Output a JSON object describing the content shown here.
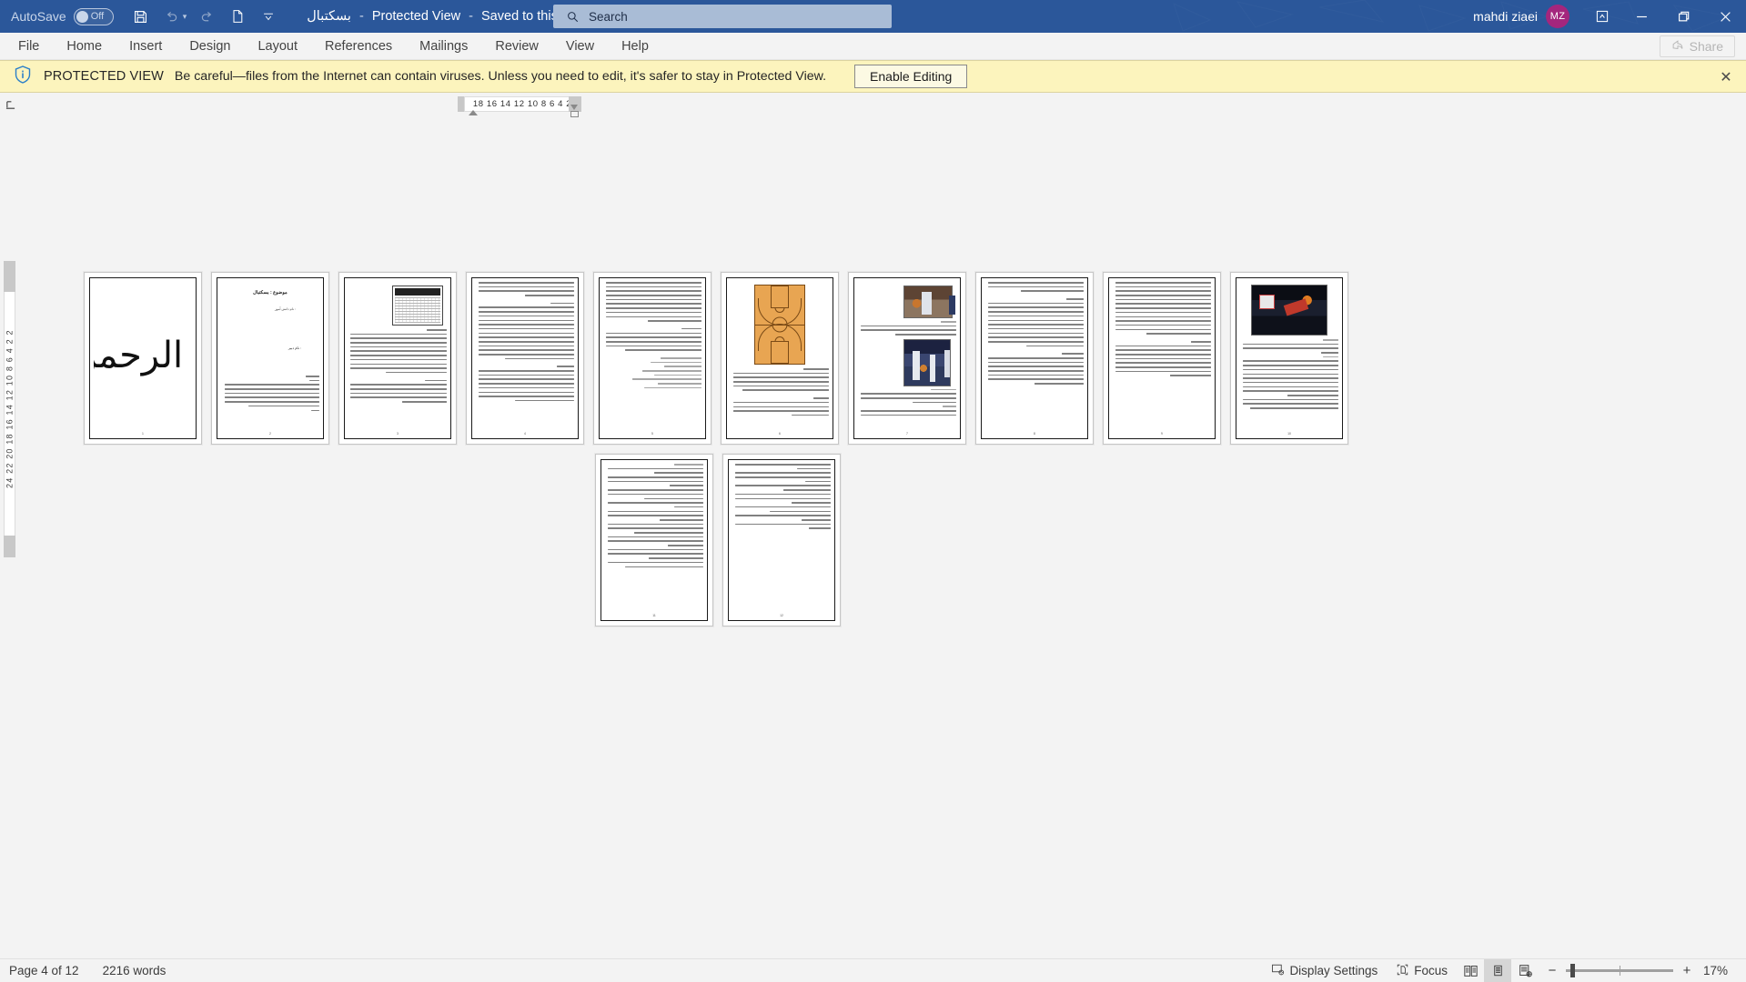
{
  "titlebar": {
    "autosave_label": "AutoSave",
    "autosave_state": "Off",
    "icons": [
      "save-icon",
      "undo-icon",
      "redo-icon",
      "new-doc-icon",
      "customize-quick-access-icon"
    ],
    "doc_name": "بسکتبال",
    "protected_view": "Protected View",
    "saved_state": "Saved to this PC",
    "user_name": "mahdi ziaei",
    "user_initials": "MZ"
  },
  "search": {
    "placeholder": "Search",
    "value": ""
  },
  "window_controls": {
    "minimize": "—",
    "restore": "❐",
    "close": "✕"
  },
  "ribbon": {
    "tabs": [
      {
        "label": "File"
      },
      {
        "label": "Home"
      },
      {
        "label": "Insert"
      },
      {
        "label": "Design"
      },
      {
        "label": "Layout"
      },
      {
        "label": "References"
      },
      {
        "label": "Mailings"
      },
      {
        "label": "Review"
      },
      {
        "label": "View"
      },
      {
        "label": "Help"
      }
    ],
    "share_label": "Share"
  },
  "protected_view_banner": {
    "strong": "PROTECTED VIEW",
    "message": "Be careful—files from the Internet can contain viruses. Unless you need to edit, it's safer to stay in Protected View.",
    "enable_button": "Enable Editing",
    "close": "✕",
    "bg_color": "#fcf4bd"
  },
  "rulers": {
    "horizontal_ticks": "18 16 14 12 10  8   6   4   2",
    "vertical_ticks": "24 22 20 18 16 14 12 10  8   6   4   2      2",
    "corner_button": "tab-selector"
  },
  "document": {
    "page_count": 12,
    "cover_calligraphy": "بسم الله الرحمن الرحیم",
    "title_page": {
      "title": "موضوع : بسکتبال",
      "line1": "نام دانش آموز :",
      "line2": "نام دبیر :"
    },
    "pages": [
      {
        "num": "1",
        "kind": "cover"
      },
      {
        "num": "2",
        "kind": "title"
      },
      {
        "num": "3",
        "kind": "text-diagram"
      },
      {
        "num": "4",
        "kind": "text"
      },
      {
        "num": "5",
        "kind": "text"
      },
      {
        "num": "6",
        "kind": "court"
      },
      {
        "num": "7",
        "kind": "photos"
      },
      {
        "num": "8",
        "kind": "text"
      },
      {
        "num": "9",
        "kind": "text"
      },
      {
        "num": "10",
        "kind": "dunk"
      },
      {
        "num": "11",
        "kind": "text"
      },
      {
        "num": "12",
        "kind": "text-short"
      }
    ]
  },
  "statusbar": {
    "page_indicator": "Page 4 of 12",
    "word_count": "2216 words",
    "display_settings": "Display Settings",
    "focus": "Focus",
    "views": [
      "read-mode-icon",
      "print-layout-icon",
      "web-layout-icon"
    ],
    "active_view": "print-layout-icon",
    "zoom_out": "−",
    "zoom_in": "+",
    "zoom_level": "17%"
  },
  "colors": {
    "titlebar": "#2b579a",
    "banner": "#fcf4bd",
    "accent_avatar": "#a4267d",
    "workspace": "#f3f3f3"
  }
}
